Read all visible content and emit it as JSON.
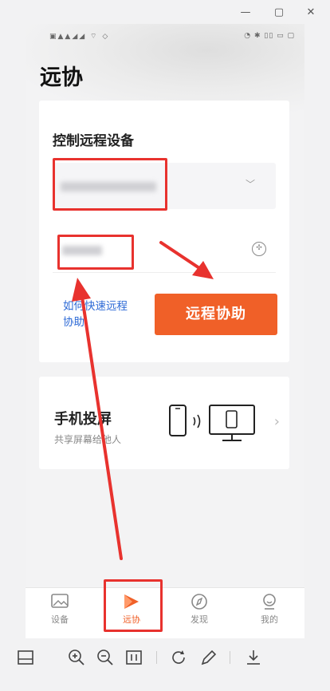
{
  "phone": {
    "title": "远协",
    "remote_card": {
      "title": "控制远程设备",
      "help_link": "如何快速远程协助",
      "assist_button": "远程协助"
    },
    "mirror_card": {
      "title": "手机投屏",
      "subtitle": "共享屏幕给他人"
    },
    "nav": [
      {
        "label": "设备",
        "icon": "image-icon"
      },
      {
        "label": "远协",
        "icon": "remote-assist-icon",
        "active": true
      },
      {
        "label": "发现",
        "icon": "compass-icon"
      },
      {
        "label": "我的",
        "icon": "profile-icon"
      }
    ]
  },
  "colors": {
    "accent": "#f06028",
    "link": "#2d6ad6",
    "annotation": "#e8322e"
  }
}
